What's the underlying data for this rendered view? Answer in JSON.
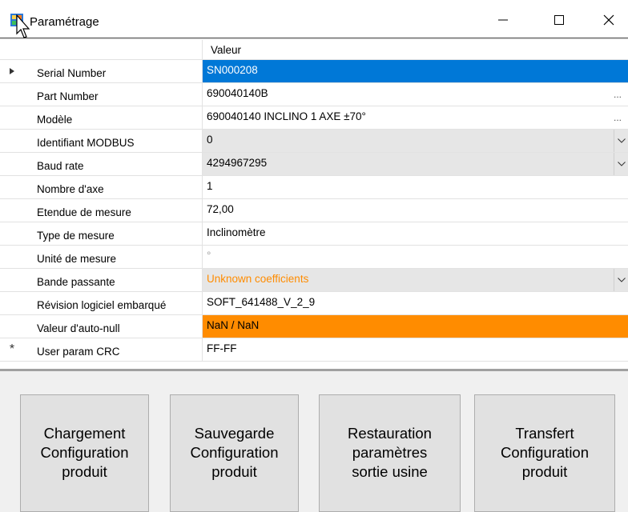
{
  "window": {
    "title": "Paramétrage",
    "minimize_icon": "minimize-icon",
    "maximize_icon": "maximize-icon",
    "close_icon": "close-icon",
    "app_icon": "app-icon"
  },
  "grid": {
    "column_header": "Valeur",
    "rows": [
      {
        "name": "Serial Number",
        "value": "SN000208",
        "style": "selected",
        "marker": "current-row-arrow",
        "editor": "text"
      },
      {
        "name": "Part Number",
        "value": "690040140B",
        "style": "normal",
        "editor": "ellipsis",
        "ellipsis": "..."
      },
      {
        "name": "Modèle",
        "value": "690040140 INCLINO 1 AXE ±70°",
        "style": "normal",
        "editor": "ellipsis",
        "ellipsis": "..."
      },
      {
        "name": "Identifiant MODBUS",
        "value": "0",
        "style": "combo",
        "editor": "combo"
      },
      {
        "name": "Baud rate",
        "value": "4294967295",
        "style": "combo",
        "editor": "combo"
      },
      {
        "name": "Nombre d'axe",
        "value": "1",
        "style": "normal",
        "editor": "text"
      },
      {
        "name": "Etendue de mesure",
        "value": "72,00",
        "style": "normal",
        "editor": "text"
      },
      {
        "name": "Type de mesure",
        "value": "Inclinomètre",
        "style": "normal",
        "editor": "text"
      },
      {
        "name": "Unité de mesure",
        "value": "°",
        "style": "dim",
        "editor": "text"
      },
      {
        "name": "Bande passante",
        "value": "Unknown coefficients",
        "style": "warn-combo",
        "editor": "combo"
      },
      {
        "name": "Révision logiciel embarqué",
        "value": "SOFT_641488_V_2_9",
        "style": "normal",
        "editor": "text"
      },
      {
        "name": "Valeur d'auto-null",
        "value": "NaN / NaN",
        "style": "orange",
        "editor": "text"
      },
      {
        "name": "User param CRC",
        "value": "FF-FF",
        "style": "normal",
        "marker": "new-row-asterisk",
        "editor": "text"
      }
    ]
  },
  "buttons": [
    {
      "label": "Chargement\nConfiguration\nproduit"
    },
    {
      "label": "Sauvegarde\nConfiguration\nproduit"
    },
    {
      "label": "Restauration\nparamètres\nsortie usine"
    },
    {
      "label": "Transfert\nConfiguration\nproduit"
    }
  ],
  "colors": {
    "selection": "#0078d7",
    "warning": "#ff8c00",
    "combo_bg": "#e6e6e6"
  }
}
